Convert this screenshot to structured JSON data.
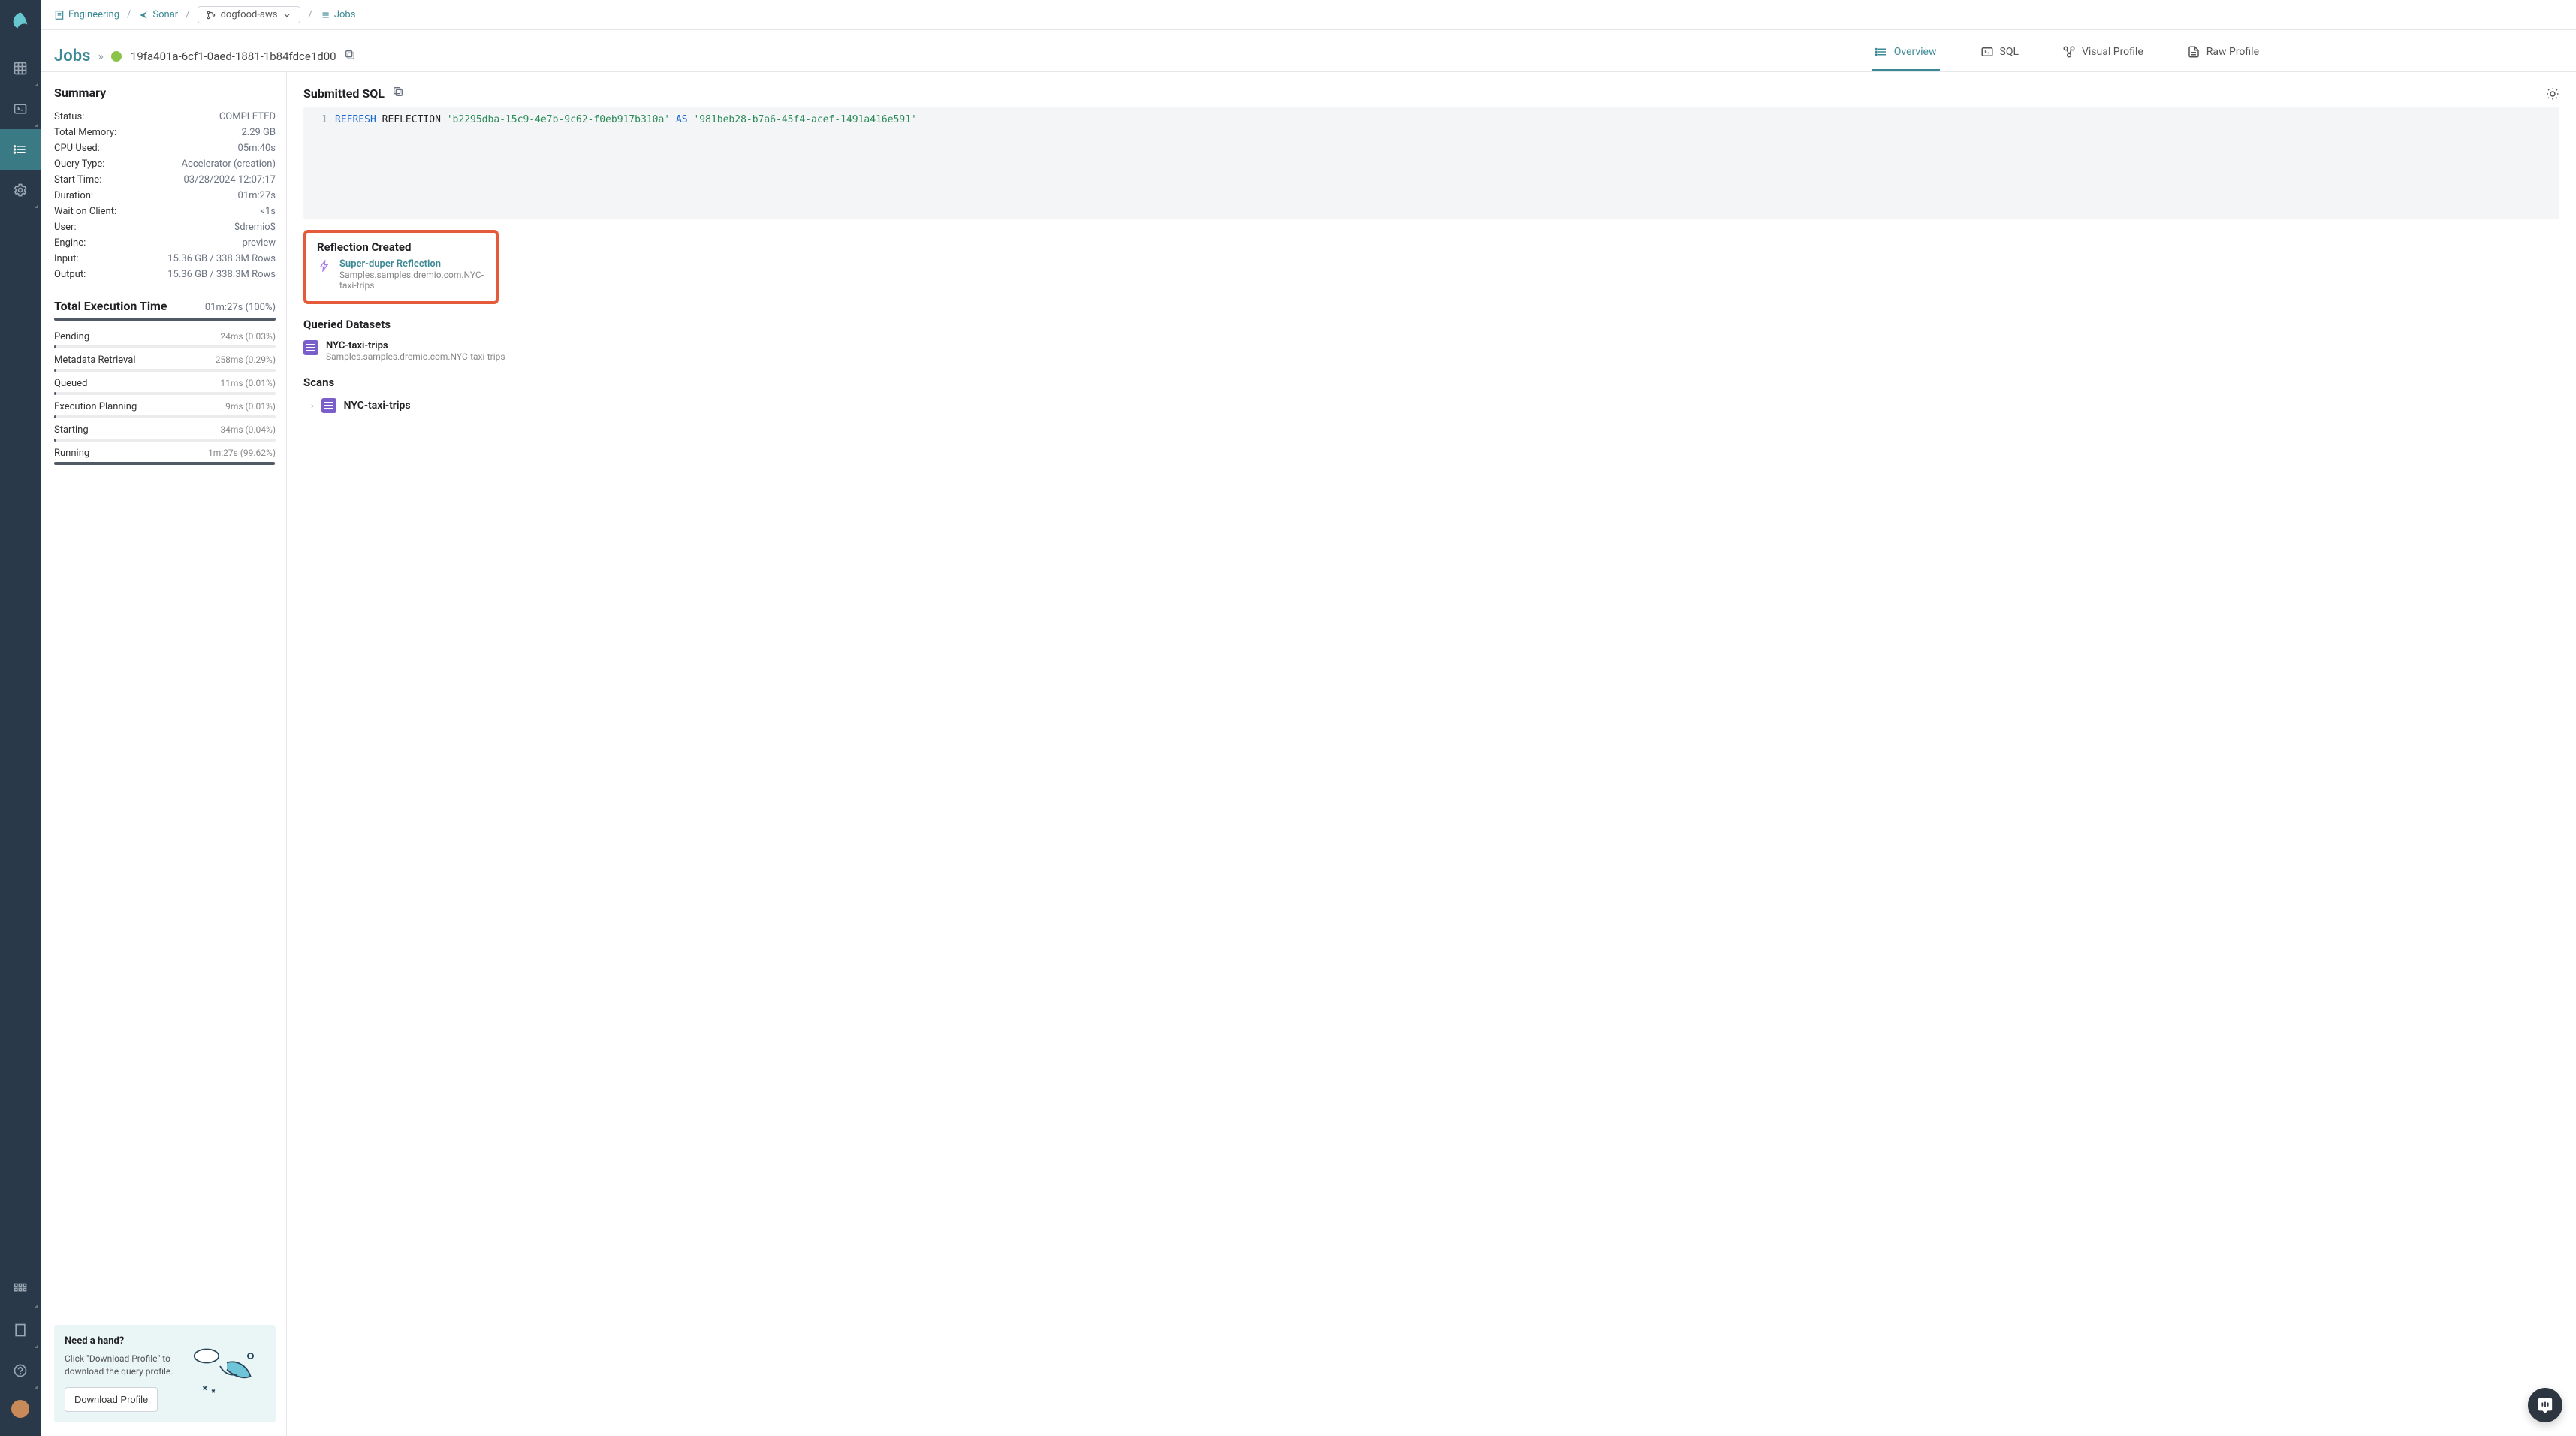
{
  "breadcrumb": {
    "item1": "Engineering",
    "item2": "Sonar",
    "branch": "dogfood-aws",
    "item3": "Jobs"
  },
  "header": {
    "jobs_label": "Jobs",
    "job_id": "19fa401a-6cf1-0aed-1881-1b84fdce1d00"
  },
  "tabs": {
    "overview": "Overview",
    "sql": "SQL",
    "visual": "Visual Profile",
    "raw": "Raw Profile"
  },
  "summary": {
    "title": "Summary",
    "rows": [
      {
        "label": "Status:",
        "value": "COMPLETED"
      },
      {
        "label": "Total Memory:",
        "value": "2.29 GB"
      },
      {
        "label": "CPU Used:",
        "value": "05m:40s"
      },
      {
        "label": "Query Type:",
        "value": "Accelerator (creation)"
      },
      {
        "label": "Start Time:",
        "value": "03/28/2024 12:07:17"
      },
      {
        "label": "Duration:",
        "value": "01m:27s"
      },
      {
        "label": "Wait on Client:",
        "value": "<1s"
      },
      {
        "label": "User:",
        "value": "$dremio$"
      },
      {
        "label": "Engine:",
        "value": "preview"
      },
      {
        "label": "Input:",
        "value": "15.36 GB / 338.3M Rows"
      },
      {
        "label": "Output:",
        "value": "15.36 GB / 338.3M Rows"
      }
    ]
  },
  "tet": {
    "title": "Total Execution Time",
    "total": "01m:27s (100%)",
    "phases": [
      {
        "name": "Pending",
        "value": "24ms (0.03%)",
        "pct": 0.03
      },
      {
        "name": "Metadata Retrieval",
        "value": "258ms (0.29%)",
        "pct": 0.29
      },
      {
        "name": "Queued",
        "value": "11ms (0.01%)",
        "pct": 0.01
      },
      {
        "name": "Execution Planning",
        "value": "9ms (0.01%)",
        "pct": 0.01
      },
      {
        "name": "Starting",
        "value": "34ms (0.04%)",
        "pct": 0.04
      },
      {
        "name": "Running",
        "value": "1m:27s (99.62%)",
        "pct": 99.62
      }
    ]
  },
  "help": {
    "title": "Need a hand?",
    "text": "Click \"Download Profile\" to download the query profile.",
    "button": "Download Profile"
  },
  "sql": {
    "title": "Submitted SQL",
    "line_no": "1",
    "kw1": "REFRESH",
    "plain1": " REFLECTION ",
    "str1": "'b2295dba-15c9-4e7b-9c62-f0eb917b310a'",
    "plain2": " ",
    "kw2": "AS",
    "plain3": " ",
    "str2": "'981beb28-b7a6-45f4-acef-1491a416e591'"
  },
  "reflection": {
    "title": "Reflection Created",
    "name": "Super-duper Reflection",
    "path": "Samples.samples.dremio.com.NYC-taxi-trips"
  },
  "queried": {
    "title": "Queried Datasets",
    "name": "NYC-taxi-trips",
    "path": "Samples.samples.dremio.com.NYC-taxi-trips"
  },
  "scans": {
    "title": "Scans",
    "name": "NYC-taxi-trips"
  }
}
